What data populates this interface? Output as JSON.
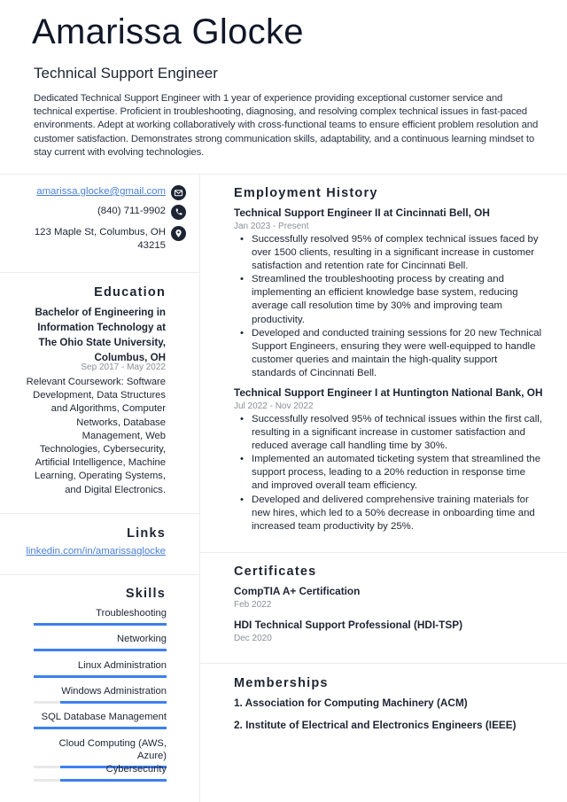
{
  "header": {
    "name": "Amarissa Glocke",
    "job_title": "Technical Support Engineer",
    "summary": "Dedicated Technical Support Engineer with 1 year of experience providing exceptional customer service and technical expertise. Proficient in troubleshooting, diagnosing, and resolving complex technical issues in fast-paced environments. Adept at working collaboratively with cross-functional teams to ensure efficient problem resolution and customer satisfaction. Demonstrates strong communication skills, adaptability, and a continuous learning mindset to stay current with evolving technologies."
  },
  "contact": {
    "email": "amarissa.glocke@gmail.com",
    "phone": "(840) 711-9902",
    "address_line1": "123 Maple St, Columbus, OH",
    "address_line2": "43215",
    "icons": [
      "envelope-icon",
      "phone-icon",
      "map-pin-icon"
    ]
  },
  "education": {
    "title": "Education",
    "degree": "Bachelor of Engineering in Information Technology at The Ohio State University, Columbus, OH",
    "dates": "Sep 2017 - May 2022",
    "description": "Relevant Coursework: Software Development, Data Structures and Algorithms, Computer Networks, Database Management, Web Technologies, Cybersecurity, Artificial Intelligence, Machine Learning, Operating Systems, and Digital Electronics."
  },
  "links": {
    "title": "Links",
    "items": [
      {
        "label": "linkedin.com/in/amarissaglocke"
      }
    ]
  },
  "skills": {
    "title": "Skills",
    "accent_color": "#3d7ff0",
    "items": [
      {
        "name": "Troubleshooting",
        "level": 1.0
      },
      {
        "name": "Networking",
        "level": 1.0
      },
      {
        "name": "Linux Administration",
        "level": 1.0
      },
      {
        "name": "Windows Administration",
        "level": 0.8
      },
      {
        "name": "SQL Database Management",
        "level": 1.0
      },
      {
        "name": "Cloud Computing (AWS, Azure)",
        "level": 0.8
      },
      {
        "name": "Cybersecurity",
        "level": 0.8
      }
    ]
  },
  "employment": {
    "title": "Employment History",
    "jobs": [
      {
        "heading": "Technical Support Engineer II at Cincinnati Bell, OH",
        "dates": "Jan 2023 - Present",
        "bullets": [
          "Successfully resolved 95% of complex technical issues faced by over 1500 clients, resulting in a significant increase in customer satisfaction and retention rate for Cincinnati Bell.",
          "Streamlined the troubleshooting process by creating and implementing an efficient knowledge base system, reducing average call resolution time by 30% and improving team productivity.",
          "Developed and conducted training sessions for 20 new Technical Support Engineers, ensuring they were well-equipped to handle customer queries and maintain the high-quality support standards of Cincinnati Bell."
        ]
      },
      {
        "heading": "Technical Support Engineer I at Huntington National Bank, OH",
        "dates": "Jul 2022 - Nov 2022",
        "bullets": [
          "Successfully resolved 95% of technical issues within the first call, resulting in a significant increase in customer satisfaction and reduced average call handling time by 30%.",
          "Implemented an automated ticketing system that streamlined the support process, leading to a 20% reduction in response time and improved overall team efficiency.",
          "Developed and delivered comprehensive training materials for new hires, which led to a 50% decrease in onboarding time and increased team productivity by 25%."
        ]
      }
    ]
  },
  "certificates": {
    "title": "Certificates",
    "items": [
      {
        "name": "CompTIA A+ Certification",
        "date": "Feb 2022"
      },
      {
        "name": "HDI Technical Support Professional (HDI-TSP)",
        "date": "Dec 2020"
      }
    ]
  },
  "memberships": {
    "title": "Memberships",
    "items": [
      "1. Association for Computing Machinery (ACM)",
      "2. Institute of Electrical and Electronics Engineers (IEEE)"
    ]
  }
}
